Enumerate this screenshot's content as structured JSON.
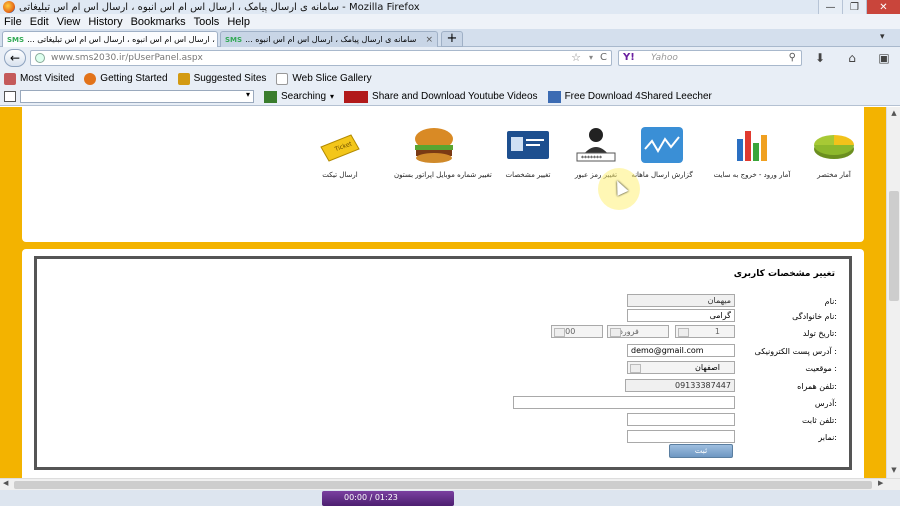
{
  "window": {
    "title": "سامانه ی ارسال پیامک ، ارسال اس ام اس انبوه ، ارسال اس ام اس تبلیغاتی - Mozilla Firefox",
    "min": "—",
    "max": "❐",
    "close": "✕"
  },
  "menu": [
    "File",
    "Edit",
    "View",
    "History",
    "Bookmarks",
    "Tools",
    "Help"
  ],
  "tabs": [
    {
      "label": "... سامانه ی ارسال پیامک ، ارسال اس ام اس انبوه ، ارسال اس ام اس تبلیغاتی",
      "close": "×",
      "prefix": "SMS"
    },
    {
      "label": "... سامانه ی ارسال پیامک ، ارسال اس ام اس انبوه",
      "close": "×",
      "prefix": "SMS"
    }
  ],
  "new_tab": "+",
  "tab_menu": "▾",
  "nav": {
    "back": "←",
    "url": "www.sms2030.ir/pUserPanel.aspx",
    "star": "☆",
    "drop": "▾",
    "reload": "C",
    "search_engine": "Y!",
    "search_placeholder": "Yahoo",
    "search_icon": "⚲",
    "download": "⬇",
    "home": "⌂",
    "menu": "▣"
  },
  "bookmarks": [
    {
      "label": "Most Visited",
      "icon": "most-visited-icon",
      "color": "#c45a5a"
    },
    {
      "label": "Getting Started",
      "icon": "firefox-icon",
      "color": "#e2731a"
    },
    {
      "label": "Suggested Sites",
      "icon": "suggested-sites-icon",
      "color": "#d39a12"
    },
    {
      "label": "Web Slice Gallery",
      "icon": "web-slice-icon",
      "color": "#ffffff"
    }
  ],
  "toolbar": {
    "combo_arrow": "▾",
    "items": [
      {
        "label": "Searching",
        "icon": "searching-icon",
        "color": "#3a7d2d",
        "arrow": "▾"
      },
      {
        "label": "Share and Download Youtube Videos",
        "icon": "youtube-icon",
        "color": "#b1191a"
      },
      {
        "label": "Free Download 4Shared Leecher",
        "icon": "leecher-icon",
        "color": "#3b6bb3"
      }
    ]
  },
  "panel_icons": [
    {
      "caption": "ارسال تیکت",
      "icon": "ticket-icon"
    },
    {
      "caption": "تغییر شماره موبایل اپراتور بستون",
      "icon": "burger-icon"
    },
    {
      "caption": "تغییر مشخصات",
      "icon": "id-card-icon"
    },
    {
      "caption": "تغییر رمز عبور",
      "icon": "user-password-icon"
    },
    {
      "caption": "گزارش ارسال ماهانه",
      "icon": "line-chart-icon"
    },
    {
      "caption": "آمار ورود - خروج به سایت",
      "icon": "bar-chart-icon"
    },
    {
      "caption": "آمار مختصر",
      "icon": "pie-chart-icon"
    }
  ],
  "form": {
    "title": "تغییر مشخصات کاربری",
    "labels": {
      "first_name": "نام:",
      "last_name": "نام خانوادگی:",
      "birth_date": "تاریخ تولد:",
      "email": "آدرس پست الکترونیکی :",
      "location": "موقعیت :",
      "mobile": "تلفن همراه:",
      "address": "آدرس:",
      "phone": "تلفن ثابت:",
      "fax": "نمابر:"
    },
    "values": {
      "first_name": "میهمان",
      "last_name": "گرامی",
      "birth_day": "1",
      "birth_month": "فروردین",
      "birth_year": "1300",
      "email": "demo@gmail.com",
      "location": "اصفهان",
      "mobile": "09133387447",
      "address": "",
      "phone": "",
      "fax": ""
    },
    "submit": "ثبت"
  },
  "media_bar": "00:00 / 01:23",
  "scroll": {
    "up": "▲",
    "down": "▼",
    "left": "◀",
    "right": "▶"
  }
}
